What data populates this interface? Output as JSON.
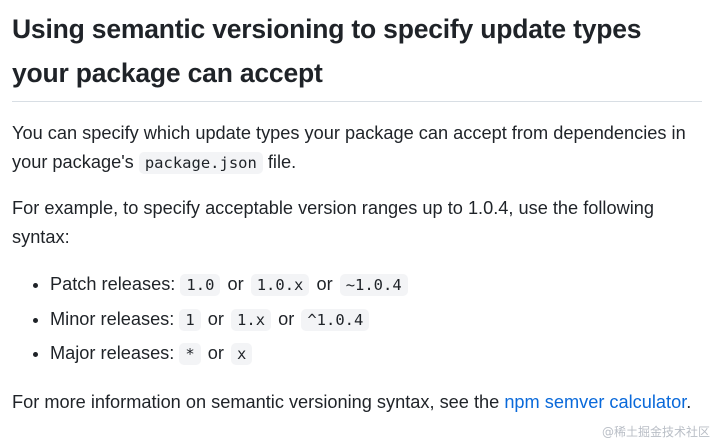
{
  "heading": "Using semantic versioning to specify update types your package can accept",
  "para1": {
    "before": "You can specify which update types your package can accept from dependencies in your package's ",
    "code": "package.json",
    "after": " file."
  },
  "para2": "For example, to specify acceptable version ranges up to 1.0.4, use the following syntax:",
  "list": [
    {
      "label": "Patch releases: ",
      "codes": [
        "1.0",
        "1.0.x",
        "~1.0.4"
      ],
      "sep": "or"
    },
    {
      "label": "Minor releases: ",
      "codes": [
        "1",
        "1.x",
        "^1.0.4"
      ],
      "sep": "or"
    },
    {
      "label": "Major releases: ",
      "codes": [
        "*",
        "x"
      ],
      "sep": "or"
    }
  ],
  "para3": {
    "before": "For more information on semantic versioning syntax, see the ",
    "link": "npm semver calculator",
    "after": "."
  },
  "watermark": "@稀土掘金技术社区"
}
